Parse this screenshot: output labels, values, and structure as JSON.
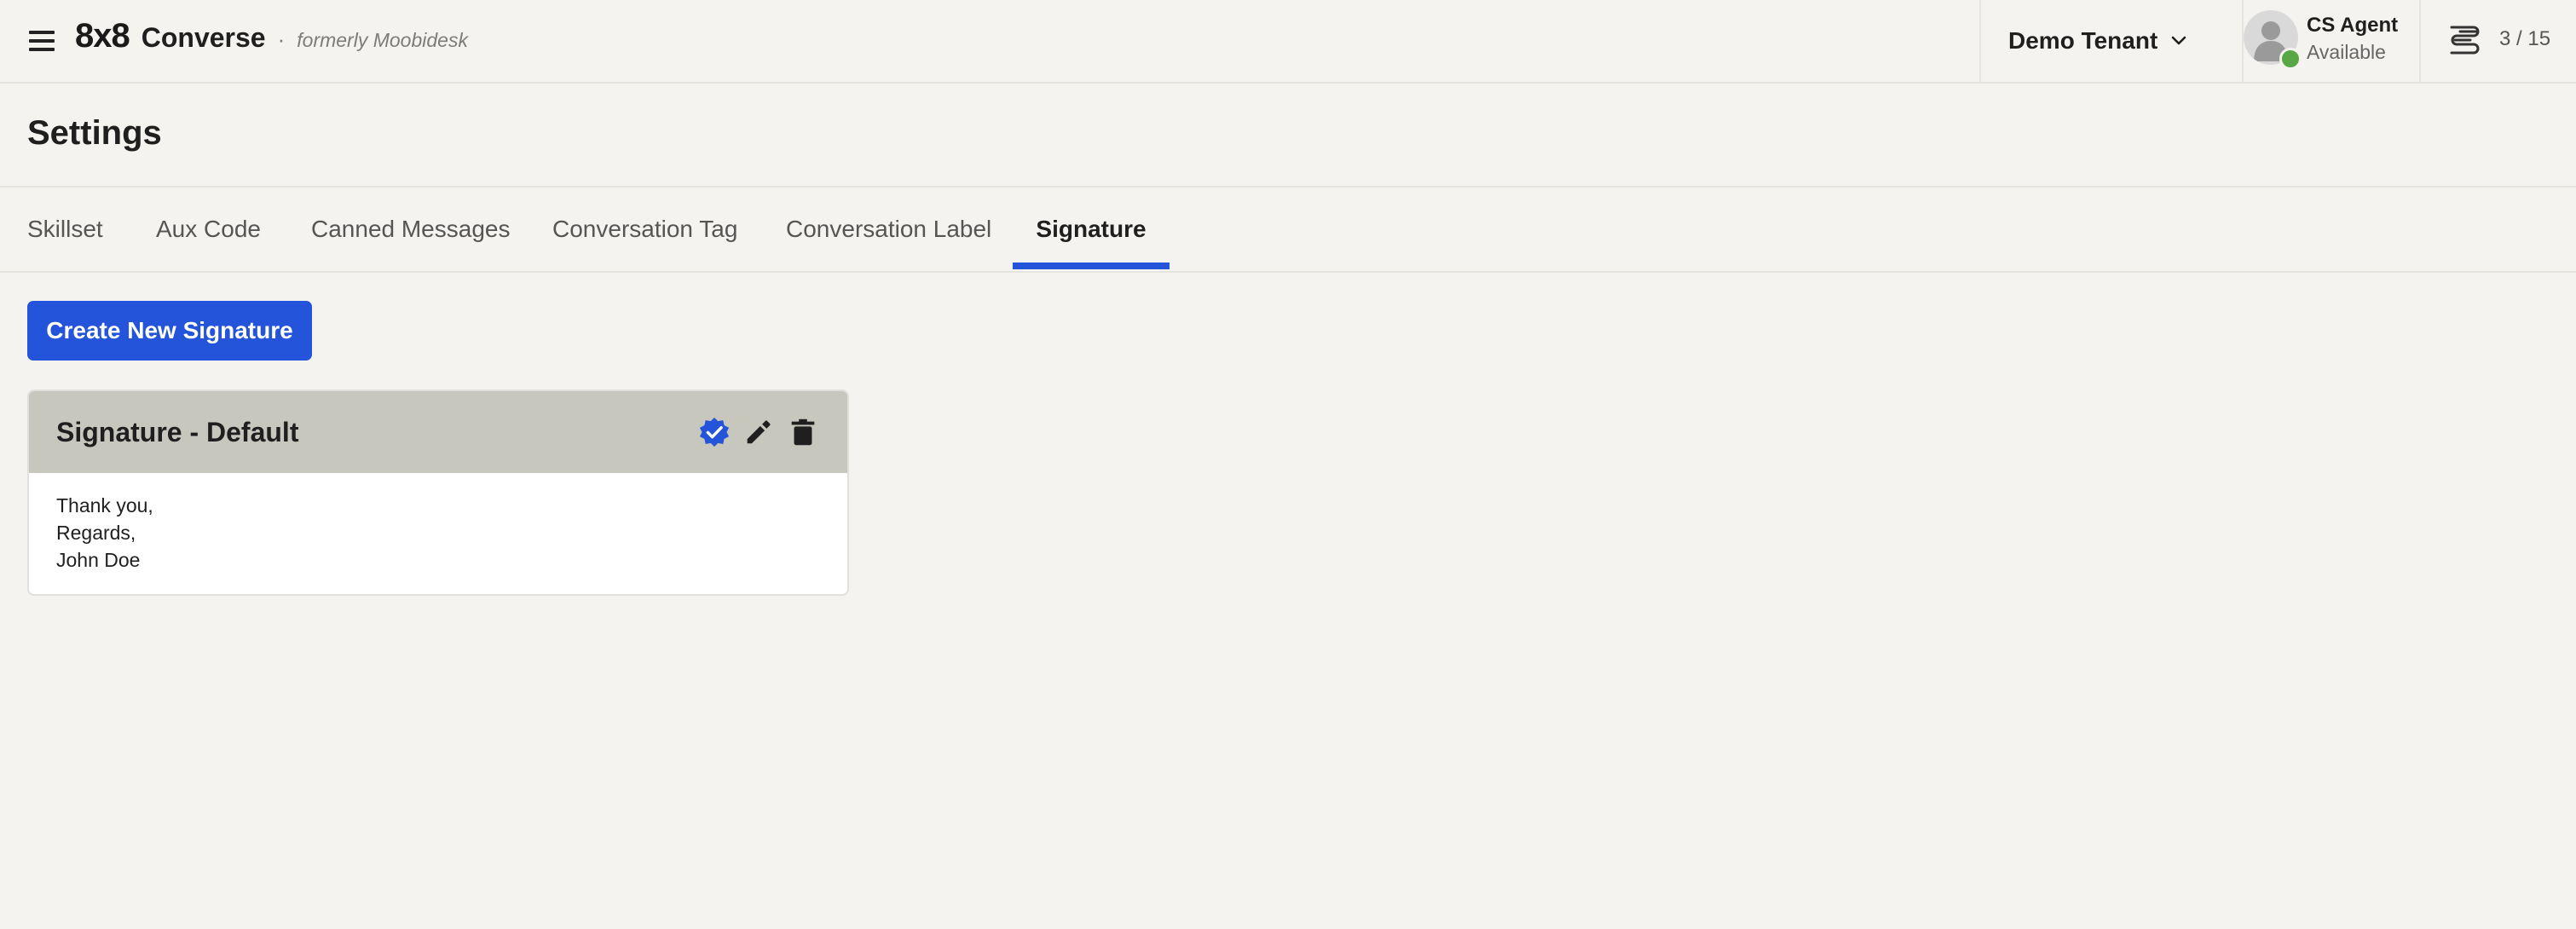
{
  "header": {
    "brand_logo": "8x8",
    "brand_product": "Converse",
    "brand_separator": "·",
    "brand_formerly": "formerly Moobidesk",
    "tenant": "Demo Tenant",
    "agent_name": "CS Agent",
    "agent_status": "Available",
    "queue_count": "3 / 15"
  },
  "page": {
    "title": "Settings"
  },
  "tabs": [
    {
      "label": "Skillset"
    },
    {
      "label": "Aux Code"
    },
    {
      "label": "Canned Messages"
    },
    {
      "label": "Conversation Tag"
    },
    {
      "label": "Conversation Label"
    },
    {
      "label": "Signature"
    }
  ],
  "active_tab": "Signature",
  "actions": {
    "create_label": "Create New Signature"
  },
  "signature": {
    "title": "Signature - Default",
    "lines": [
      "Thank you,",
      "Regards,",
      "John Doe"
    ]
  },
  "icons": {
    "menu": "hamburger-menu-icon",
    "chevron": "chevron-down-icon",
    "queue": "queue-icon",
    "default": "verified-badge-icon",
    "edit": "pencil-icon",
    "delete": "trash-icon"
  },
  "colors": {
    "accent": "#2354d9",
    "status_available": "#57a845",
    "card_header": "#c8c7be",
    "background": "#f4f3ef"
  }
}
